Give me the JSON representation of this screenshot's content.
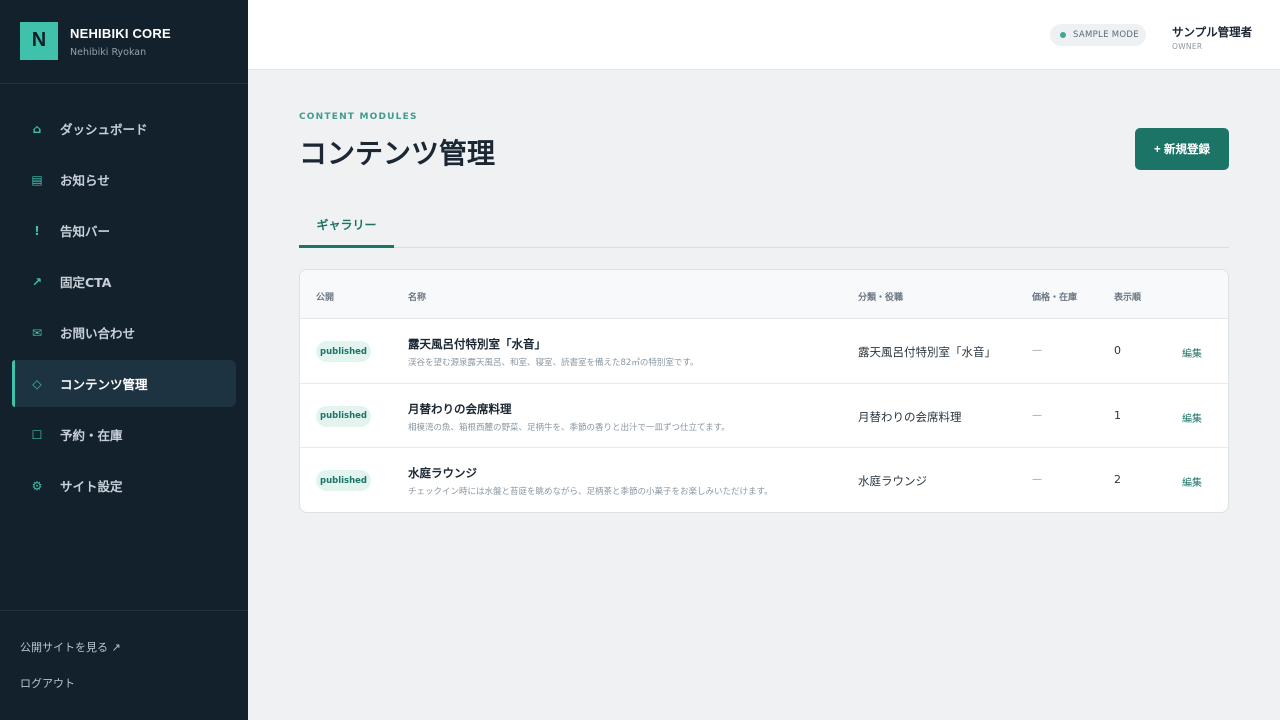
{
  "brand": {
    "logo_letter": "N",
    "title": "NEHIBIKI CORE",
    "subtitle": "Nehibiki Ryokan"
  },
  "sidebar": {
    "items": [
      {
        "label": "ダッシュボード",
        "icon": "home-icon",
        "glyph": "⌂",
        "active": false
      },
      {
        "label": "お知らせ",
        "icon": "news-icon",
        "glyph": "▤",
        "active": false
      },
      {
        "label": "告知バー",
        "icon": "alert-icon",
        "glyph": "!",
        "active": false
      },
      {
        "label": "固定CTA",
        "icon": "arrow-up-right-icon",
        "glyph": "↗",
        "active": false
      },
      {
        "label": "お問い合わせ",
        "icon": "mail-icon",
        "glyph": "✉",
        "active": false
      },
      {
        "label": "コンテンツ管理",
        "icon": "diamond-icon",
        "glyph": "◇",
        "active": true
      },
      {
        "label": "予約・在庫",
        "icon": "square-icon",
        "glyph": "☐",
        "active": false
      },
      {
        "label": "サイト設定",
        "icon": "gear-icon",
        "glyph": "⚙",
        "active": false
      }
    ],
    "footer": {
      "view_site": "公開サイトを見る ↗",
      "logout": "ログアウト"
    }
  },
  "header": {
    "mode": "SAMPLE MODE",
    "user_name": "サンプル管理者",
    "user_role": "OWNER"
  },
  "main": {
    "eyebrow": "CONTENT MODULES",
    "title": "コンテンツ管理",
    "new_button": "+ 新規登録",
    "tabs": [
      {
        "label": "ギャラリー"
      }
    ]
  },
  "table": {
    "headers": {
      "status": "公開",
      "name": "名称",
      "category": "分類・役職",
      "price": "価格・在庫",
      "order": "表示順"
    },
    "rows": [
      {
        "status": "published",
        "name": "露天風呂付特別室「水音」",
        "desc": "渓谷を望む源泉露天風呂、和室、寝室、読書室を備えた82㎡の特別室です。",
        "category": "露天風呂付特別室「水音」",
        "price": "—",
        "order": "0",
        "action": "編集"
      },
      {
        "status": "published",
        "name": "月替わりの会席料理",
        "desc": "相模湾の魚、箱根西麓の野菜、足柄牛を、季節の香りと出汁で一皿ずつ仕立てます。",
        "category": "月替わりの会席料理",
        "price": "—",
        "order": "1",
        "action": "編集"
      },
      {
        "status": "published",
        "name": "水庭ラウンジ",
        "desc": "チェックイン時には水盤と苔庭を眺めながら、足柄茶と季節の小菓子をお楽しみいただけます。",
        "category": "水庭ラウンジ",
        "price": "—",
        "order": "2",
        "action": "編集"
      }
    ]
  },
  "colors": {
    "sidebar_bg": "#13212d",
    "accent": "#3fc1ab",
    "primary": "#1c7466"
  }
}
